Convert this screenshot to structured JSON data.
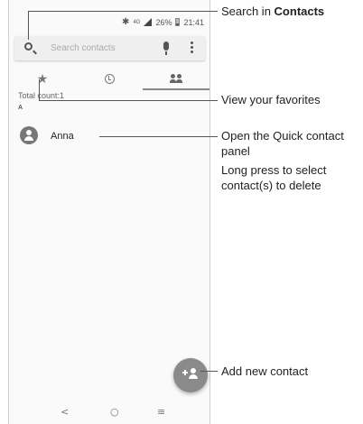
{
  "status_bar": {
    "network": "4G",
    "battery": "26%",
    "time": "21:41"
  },
  "search": {
    "placeholder": "Search contacts"
  },
  "tabs": [
    {
      "name": "favorites",
      "icon": "star-icon"
    },
    {
      "name": "recent",
      "icon": "clock-icon"
    },
    {
      "name": "contacts",
      "icon": "people-icon"
    }
  ],
  "list": {
    "total_count": "Total count:1",
    "section": "A",
    "contacts": [
      {
        "name": "Anna"
      }
    ]
  },
  "nav": {
    "back": "<",
    "home": "○",
    "recents": "≡"
  },
  "annotations": {
    "search_prefix": "Search in ",
    "search_bold": "Contacts",
    "favorites": "View your favorites",
    "quick_contact_1": "Open the Quick contact",
    "quick_contact_2": "panel",
    "long_press_1": "Long press to select",
    "long_press_2": "contact(s) to delete",
    "add_contact": "Add new contact"
  },
  "colors": {
    "accent": "#8a8a8a",
    "background": "#fafafa"
  }
}
